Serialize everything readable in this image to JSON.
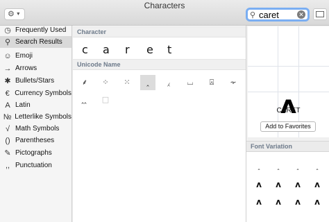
{
  "window": {
    "title": "Characters"
  },
  "toolbar": {
    "gear_icon": "gear-icon"
  },
  "search": {
    "value": "caret",
    "placeholder": ""
  },
  "sidebar": {
    "items": [
      {
        "label": "Frequently Used",
        "icon": "clock-icon",
        "glyph": "◷"
      },
      {
        "label": "Search Results",
        "icon": "search-icon",
        "glyph": "⚲"
      },
      {
        "label": "Emoji",
        "icon": "smiley-icon",
        "glyph": "☺"
      },
      {
        "label": "Arrows",
        "icon": "arrow-icon",
        "glyph": "→"
      },
      {
        "label": "Bullets/Stars",
        "icon": "star-icon",
        "glyph": "✱"
      },
      {
        "label": "Currency Symbols",
        "icon": "currency-icon",
        "glyph": "€"
      },
      {
        "label": "Latin",
        "icon": "latin-icon",
        "glyph": "A"
      },
      {
        "label": "Letterlike Symbols",
        "icon": "numero-icon",
        "glyph": "№"
      },
      {
        "label": "Math Symbols",
        "icon": "sqrt-icon",
        "glyph": "√"
      },
      {
        "label": "Parentheses",
        "icon": "parentheses-icon",
        "glyph": "()"
      },
      {
        "label": "Pictographs",
        "icon": "pencil-icon",
        "glyph": "✎"
      },
      {
        "label": "Punctuation",
        "icon": "punctuation-icon",
        "glyph": ",,"
      }
    ],
    "selected": "Search Results"
  },
  "main": {
    "character_header": "Character",
    "character_letters": [
      "c",
      "a",
      "r",
      "e",
      "t"
    ],
    "unicode_header": "Unicode Name",
    "glyphs": [
      "⸙",
      "⁘",
      "⁙",
      "‸",
      "⁁",
      "⌴",
      "⍓",
      "⸟",
      "‸‸",
      "□"
    ]
  },
  "detail": {
    "big_glyph": "ʌ",
    "name": "CARET",
    "add_favorites": "Add to Favorites",
    "font_variation_header": "Font Variation",
    "variations": [
      "‸",
      "‸",
      "‸",
      "‸",
      "ʌ",
      "ʌ",
      "ʌ",
      "ʌ",
      "ʌ",
      "ʌ",
      "ʌ",
      "ʌ"
    ]
  }
}
